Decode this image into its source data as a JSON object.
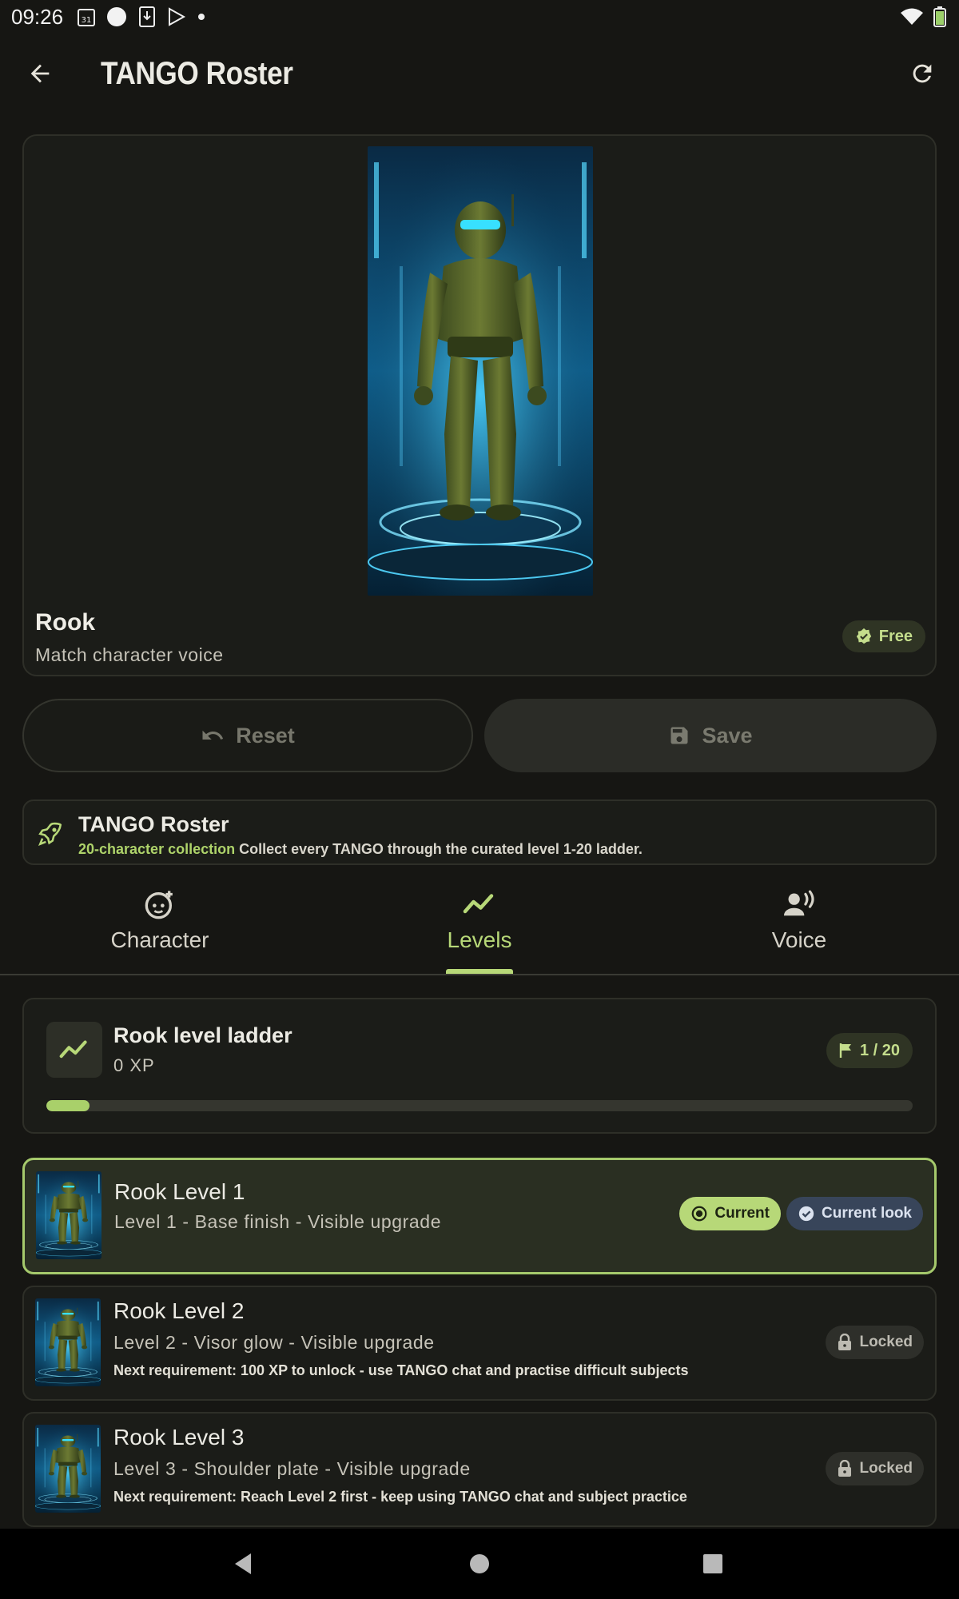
{
  "status_bar": {
    "time": "09:26",
    "left_icons": [
      "calendar-icon",
      "circle-icon",
      "download-icon",
      "play-store-icon",
      "dot-icon"
    ],
    "right_icons": [
      "wifi-icon",
      "battery-icon"
    ]
  },
  "app_bar": {
    "title": "TANGO Roster",
    "back_icon": "arrow-back-icon",
    "refresh_icon": "refresh-icon"
  },
  "hero": {
    "name": "Rook",
    "subtitle": "Match character voice",
    "badge": "Free"
  },
  "actions": {
    "reset_label": "Reset",
    "save_label": "Save"
  },
  "banner": {
    "title": "TANGO Roster",
    "highlight": "20-character collection",
    "text": "Collect every TANGO through the curated level 1-20 ladder."
  },
  "tabs": [
    {
      "label": "Character",
      "icon": "face-icon",
      "active": false
    },
    {
      "label": "Levels",
      "icon": "trend-icon",
      "active": true
    },
    {
      "label": "Voice",
      "icon": "voice-icon",
      "active": false
    }
  ],
  "ladder": {
    "title": "Rook level ladder",
    "xp": "0 XP",
    "level_badge": "1 / 20",
    "progress": 0.05
  },
  "levels": [
    {
      "title": "Rook Level 1",
      "subtitle": "Level 1 - Base finish - Visible upgrade",
      "requirement": "",
      "badge_current": "Current",
      "badge_look": "Current look",
      "state": "current"
    },
    {
      "title": "Rook Level 2",
      "subtitle": "Level 2 - Visor glow - Visible upgrade",
      "requirement": "Next requirement: 100 XP to unlock - use TANGO chat and practise difficult subjects",
      "badge_locked": "Locked",
      "state": "locked"
    },
    {
      "title": "Rook Level 3",
      "subtitle": "Level 3 - Shoulder plate - Visible upgrade",
      "requirement": "Next requirement: Reach Level 2 first - keep using TANGO chat and subject practice",
      "badge_locked": "Locked",
      "state": "locked"
    }
  ],
  "colors": {
    "background": "#161613",
    "accent": "#b7d878",
    "card": "#1b1c18",
    "current_row": "#2a2f22",
    "look_badge": "#38455a"
  }
}
